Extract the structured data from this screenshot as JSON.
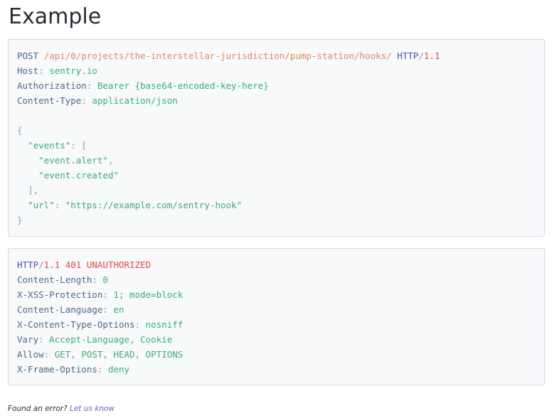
{
  "title": "Example",
  "request": {
    "method": "POST",
    "path": "/api/0/projects/the-interstellar-jurisdiction/pump-station/hooks/",
    "protocol": "HTTP",
    "slash": "/",
    "version": "1.1",
    "headers": [
      {
        "key": "Host",
        "value": "sentry.io"
      },
      {
        "key": "Authorization",
        "value": "Bearer {base64-encoded-key-here}"
      },
      {
        "key": "Content-Type",
        "value": "application/json"
      }
    ],
    "body": {
      "open_brace": "{",
      "events_key": "\"events\"",
      "colon": ": ",
      "open_bracket": "[",
      "event_1": "\"event.alert\"",
      "comma": ",",
      "event_2": "\"event.created\"",
      "close_bracket": "],",
      "url_key": "\"url\"",
      "url_value": "\"https://example.com/sentry-hook\"",
      "close_brace": "}"
    }
  },
  "response": {
    "protocol": "HTTP",
    "slash": "/",
    "version": "1.1",
    "status": "401 UNAUTHORIZED",
    "headers": [
      {
        "key": "Content-Length",
        "value": "0"
      },
      {
        "key": "X-XSS-Protection",
        "value": "1; mode=block"
      },
      {
        "key": "Content-Language",
        "value": "en"
      },
      {
        "key": "X-Content-Type-Options",
        "value": "nosniff"
      },
      {
        "key": "Vary",
        "value": "Accept-Language, Cookie"
      },
      {
        "key": "Allow",
        "value": "GET, POST, HEAD, OPTIONS"
      },
      {
        "key": "X-Frame-Options",
        "value": "deny"
      }
    ]
  },
  "footer": {
    "text": "Found an error?",
    "link": "Let us know"
  }
}
